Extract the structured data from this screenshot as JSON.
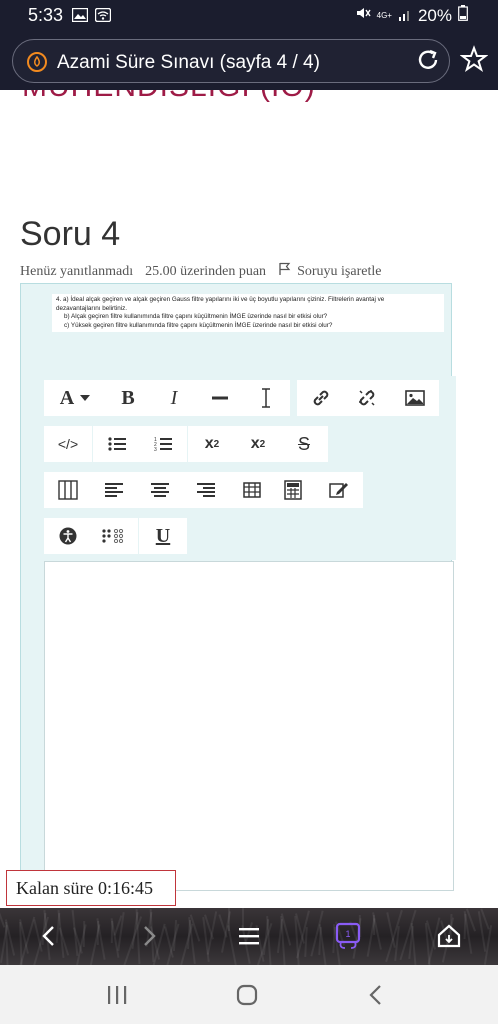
{
  "status_bar": {
    "time": "5:33",
    "battery": "20%",
    "network": "4G+"
  },
  "browser": {
    "tab_title": "Azami Süre Sınavı (sayfa 4 / 4)"
  },
  "page": {
    "course_title_partial": "MÜHENDİSLİĞİ (İÖ)",
    "question_title": "Soru 4",
    "status": "Henüz yanıtlanmadı",
    "points": "25.00 üzerinden puan",
    "flag_label": "Soruyu işaretle",
    "question_lines": [
      "4. a) İdeal alçak geçiren ve alçak geçiren Gauss filtre yapılarını iki ve üç boyutlu yapılarını çiziniz. Filtrelerin avantaj ve",
      "dezavantajlarını belirtiniz.",
      "b) Alçak geçiren filtre kullanımında filtre çapını küçültmenin İMGE üzerinde nasıl bir etkisi olur?",
      "c) Yüksek geçiren filtre kullanımında filtre çapını küçültmenin İMGE üzerinde nasıl bir etkisi olur?"
    ]
  },
  "toolbar": {
    "font_label": "A",
    "bold_label": "B",
    "italic_label": "I",
    "underline_label": "U",
    "strike_label": "S",
    "subscript_label": "x",
    "subscript_sub": "2",
    "superscript_label": "x",
    "superscript_sup": "2",
    "code_label": "</>"
  },
  "timer": {
    "label": "Kalan süre 0:16:45"
  },
  "colors": {
    "accent": "#9e1b46",
    "question_bg": "#e6f4f5",
    "timer_border": "#c0353b",
    "bar_bg": "#1b1d2e"
  }
}
